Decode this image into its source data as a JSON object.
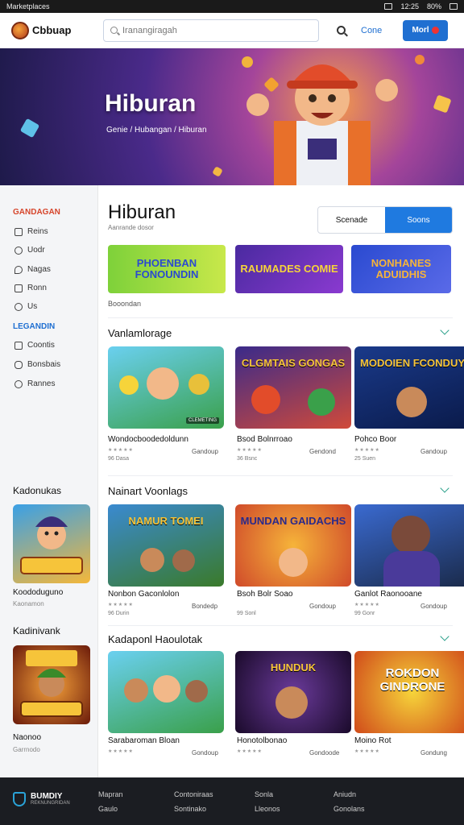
{
  "status_bar": {
    "app": "Marketplaces",
    "time": "12:25",
    "battery": "80%"
  },
  "header": {
    "logo_text": "Cbbuap",
    "search_placeholder": "Iranangiragah",
    "link": "Cone",
    "cta": "Morl"
  },
  "hero": {
    "title": "Hiburan",
    "subtitle": "Genie / Hubangan / Hiburan"
  },
  "sidebar": {
    "section1": "GANDAGAN",
    "items1": [
      {
        "label": "Reins",
        "icon": "triangle-icon"
      },
      {
        "label": "Uodr",
        "icon": "circle-icon"
      },
      {
        "label": "Nagas",
        "icon": "map-pin-icon"
      },
      {
        "label": "Ronn",
        "icon": "book-icon"
      },
      {
        "label": "Us",
        "icon": "user-icon"
      }
    ],
    "section2": "LEGANDIN",
    "items2": [
      {
        "label": "Coontis",
        "icon": "box-icon"
      },
      {
        "label": "Bonsbais",
        "icon": "gamepad-icon"
      },
      {
        "label": "Rannes",
        "icon": "chat-icon"
      }
    ],
    "promo1": {
      "heading": "Kadonukas",
      "title": "Koododuguno",
      "sub": "Kaonamon"
    },
    "promo2": {
      "heading": "Kadinivank",
      "title": "Naonoo",
      "sub": "Garrnodo"
    }
  },
  "main": {
    "title": "Hiburan",
    "subtitle": "Aanrande dosor",
    "seg": {
      "left": "Scenade",
      "right": "Soons"
    },
    "banners": [
      "PHOENBAN FONOUNDIN",
      "RAUMADES COMIE",
      "NONHANES ADUIDHIS"
    ],
    "banner_caption": "Booondan",
    "sections": [
      {
        "title": "Vanlamlorage",
        "cards": [
          {
            "art": "CLEMETING",
            "title": "Wondocboodedoldunn",
            "genre": "Gandoup",
            "meta": "96 Dasa"
          },
          {
            "art": "CLGMTAIS GONGAS",
            "title": "Bsod Bolnrroao",
            "genre": "Gendond",
            "meta": "36 Bsnc"
          },
          {
            "art": "MODOIEN FCONDUY",
            "title": "Pohco Boor",
            "genre": "Gandoup",
            "meta": "25 Suen"
          }
        ]
      },
      {
        "title": "Nainart Voonlags",
        "cards": [
          {
            "art": "NAMUR TOMEI",
            "title": "Nonbon Gaconlolon",
            "genre": "Bondedp",
            "meta": "96 Durin"
          },
          {
            "art": "MUNDAN GAIDACHS",
            "title": "Bsoh Bolr Soao",
            "genre": "Gondoup",
            "meta": "99 Sonl"
          },
          {
            "art": "",
            "title": "Ganlot Raonooane",
            "genre": "Gondoup",
            "meta": "99 Gonr"
          }
        ]
      },
      {
        "title": "Kadaponl Haoulotak",
        "cards": [
          {
            "art": "",
            "title": "Sarabaroman Bloan",
            "genre": "Gondoup",
            "meta": ""
          },
          {
            "art": "HUNDUK",
            "title": "Honotolbonao",
            "genre": "Gondoode",
            "meta": ""
          },
          {
            "art": "ROKDON GINDRONE",
            "title": "Moino Rot",
            "genre": "Gondung",
            "meta": ""
          }
        ]
      }
    ]
  },
  "footer": {
    "brand": "BUMDIY",
    "tagline": "REKNUNGRIDAN",
    "cols": [
      [
        "Mapran",
        "Gaulo"
      ],
      [
        "Contoniraas",
        "Sontinako"
      ],
      [
        "Sonla",
        "Lleonos"
      ],
      [
        "Aniudn",
        "Gonolans"
      ]
    ]
  }
}
